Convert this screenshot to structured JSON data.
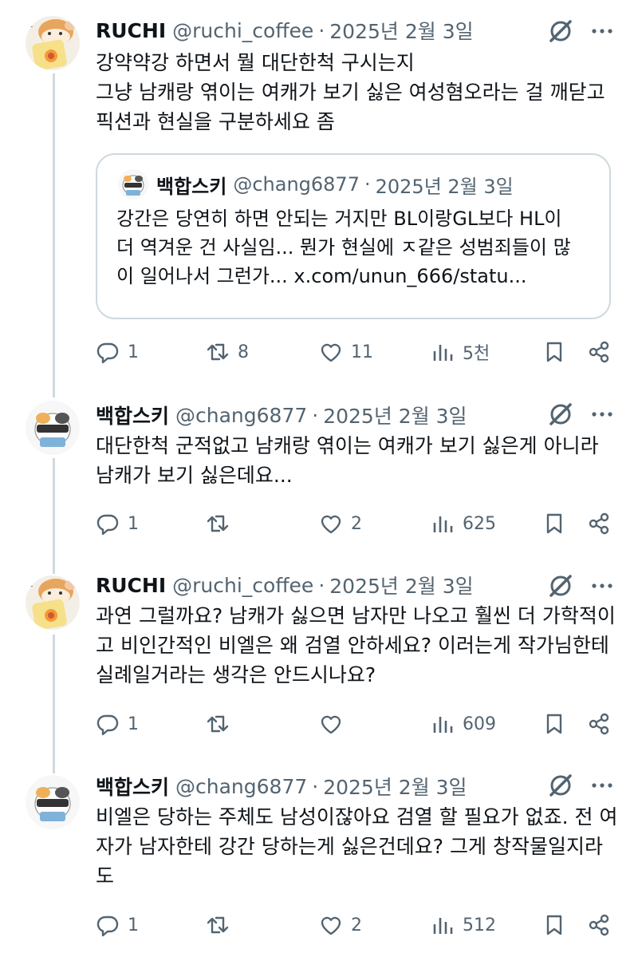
{
  "tweets": [
    {
      "name": "RUCHI",
      "handle": "@ruchi_coffee",
      "date": "2025년 2월 3일",
      "text": "강약약강 하면서 뭘 대단한척 구시는지\n그냥 남캐랑 엮이는 여캐가 보기 싫은 여성혐오라는 걸 깨닫고\n픽션과 현실을 구분하세요 좀",
      "quote": {
        "name": "백합스키",
        "handle": "@chang6877",
        "date": "2025년 2월 3일",
        "text": "강간은 당연히 하면 안되는 거지만 BL이랑GL보다 HL이\n더 역겨운 건 사실임... 뭔가 현실에 ㅈ같은 성범죄들이 많\n이 일어나서 그런가... x.com/unun_666/statu..."
      },
      "replies": "1",
      "retweets": "8",
      "likes": "11",
      "views": "5천"
    },
    {
      "name": "백합스키",
      "handle": "@chang6877",
      "date": "2025년 2월 3일",
      "text": "대단한척 군적없고 남캐랑 엮이는 여캐가 보기 싫은게 아니라\n남캐가 보기 싫은데요...",
      "replies": "1",
      "retweets": "",
      "likes": "2",
      "views": "625"
    },
    {
      "name": "RUCHI",
      "handle": "@ruchi_coffee",
      "date": "2025년 2월 3일",
      "text": "과연 그럴까요? 남캐가 싫으면 남자만 나오고 훨씬 더 가학적이\n고 비인간적인 비엘은 왜 검열 안하세요?  이러는게 작가님한테\n실례일거라는 생각은 안드시나요?",
      "replies": "1",
      "retweets": "",
      "likes": "",
      "views": "609"
    },
    {
      "name": "백합스키",
      "handle": "@chang6877",
      "date": "2025년 2월 3일",
      "text": "비엘은 당하는 주체도 남성이잖아요 검열 할 필요가 없죠. 전 여\n자가 남자한테 강간 당하는게 싫은건데요? 그게 창작물일지라\n도",
      "replies": "1",
      "retweets": "",
      "likes": "2",
      "views": "512"
    }
  ],
  "colors": {
    "text": "#0f1419",
    "secondary": "#536471",
    "border": "#cfd9de"
  },
  "icons": [
    "reply-icon",
    "retweet-icon",
    "like-icon",
    "views-icon",
    "bookmark-icon",
    "share-icon",
    "grok-icon",
    "more-icon"
  ]
}
